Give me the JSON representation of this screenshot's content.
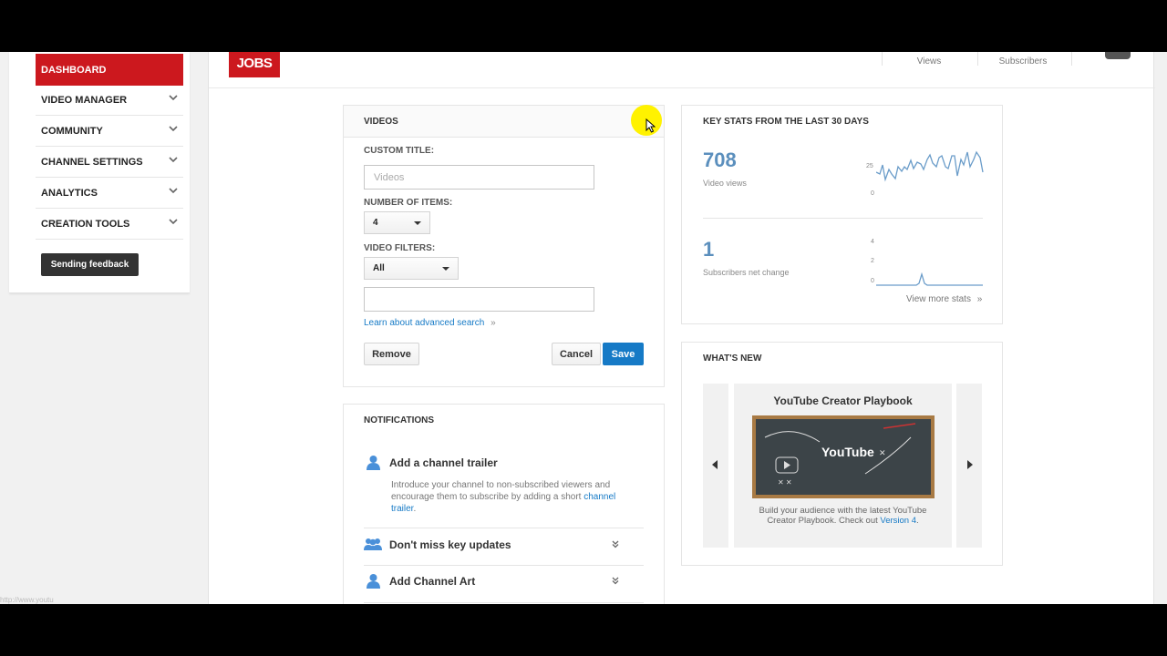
{
  "sidebar": {
    "items": [
      {
        "label": "DASHBOARD"
      },
      {
        "label": "VIDEO MANAGER"
      },
      {
        "label": "COMMUNITY"
      },
      {
        "label": "CHANNEL SETTINGS"
      },
      {
        "label": "ANALYTICS"
      },
      {
        "label": "CREATION TOOLS"
      }
    ],
    "feedback_label": "Sending feedback"
  },
  "header": {
    "logo_text": "JOBS",
    "stats": [
      {
        "label": "Views"
      },
      {
        "label": "Subscribers"
      }
    ]
  },
  "videos_card": {
    "title": "VIDEOS",
    "custom_title_label": "CUSTOM TITLE:",
    "custom_title_placeholder": "Videos",
    "items_label": "NUMBER OF ITEMS:",
    "items_value": "4",
    "filters_label": "VIDEO FILTERS:",
    "filters_value": "All",
    "advanced_link": "Learn about advanced search",
    "advanced_arrow": "»",
    "remove_label": "Remove",
    "cancel_label": "Cancel",
    "save_label": "Save"
  },
  "notifications": {
    "title": "NOTIFICATIONS",
    "items": [
      {
        "title": "Add a channel trailer",
        "body": "Introduce your channel to non-subscribed viewers and encourage them to subscribe by adding a short ",
        "link": "channel trailer",
        "suffix": "."
      },
      {
        "title": "Don't miss key updates"
      },
      {
        "title": "Add Channel Art"
      }
    ]
  },
  "key_stats": {
    "title": "KEY STATS FROM THE LAST 30 DAYS",
    "views_value": "708",
    "views_label": "Video views",
    "views_axis": [
      "25",
      "0"
    ],
    "subs_value": "1",
    "subs_label": "Subscribers net change",
    "subs_axis": [
      "4",
      "2",
      "0"
    ],
    "more_link": "View more stats",
    "more_arrow": "»"
  },
  "whats_new": {
    "title": "WHAT'S NEW",
    "promo_title": "YouTube Creator Playbook",
    "promo_image_text": "YouTube",
    "promo_body": "Build your audience with the latest YouTube Creator Playbook. Check out ",
    "promo_link": "Version 4",
    "promo_suffix": "."
  },
  "status_url": "http://www.youtu",
  "colors": {
    "brand": "#cc181e",
    "accent": "#167ac6",
    "chart": "#6a9cc9"
  }
}
